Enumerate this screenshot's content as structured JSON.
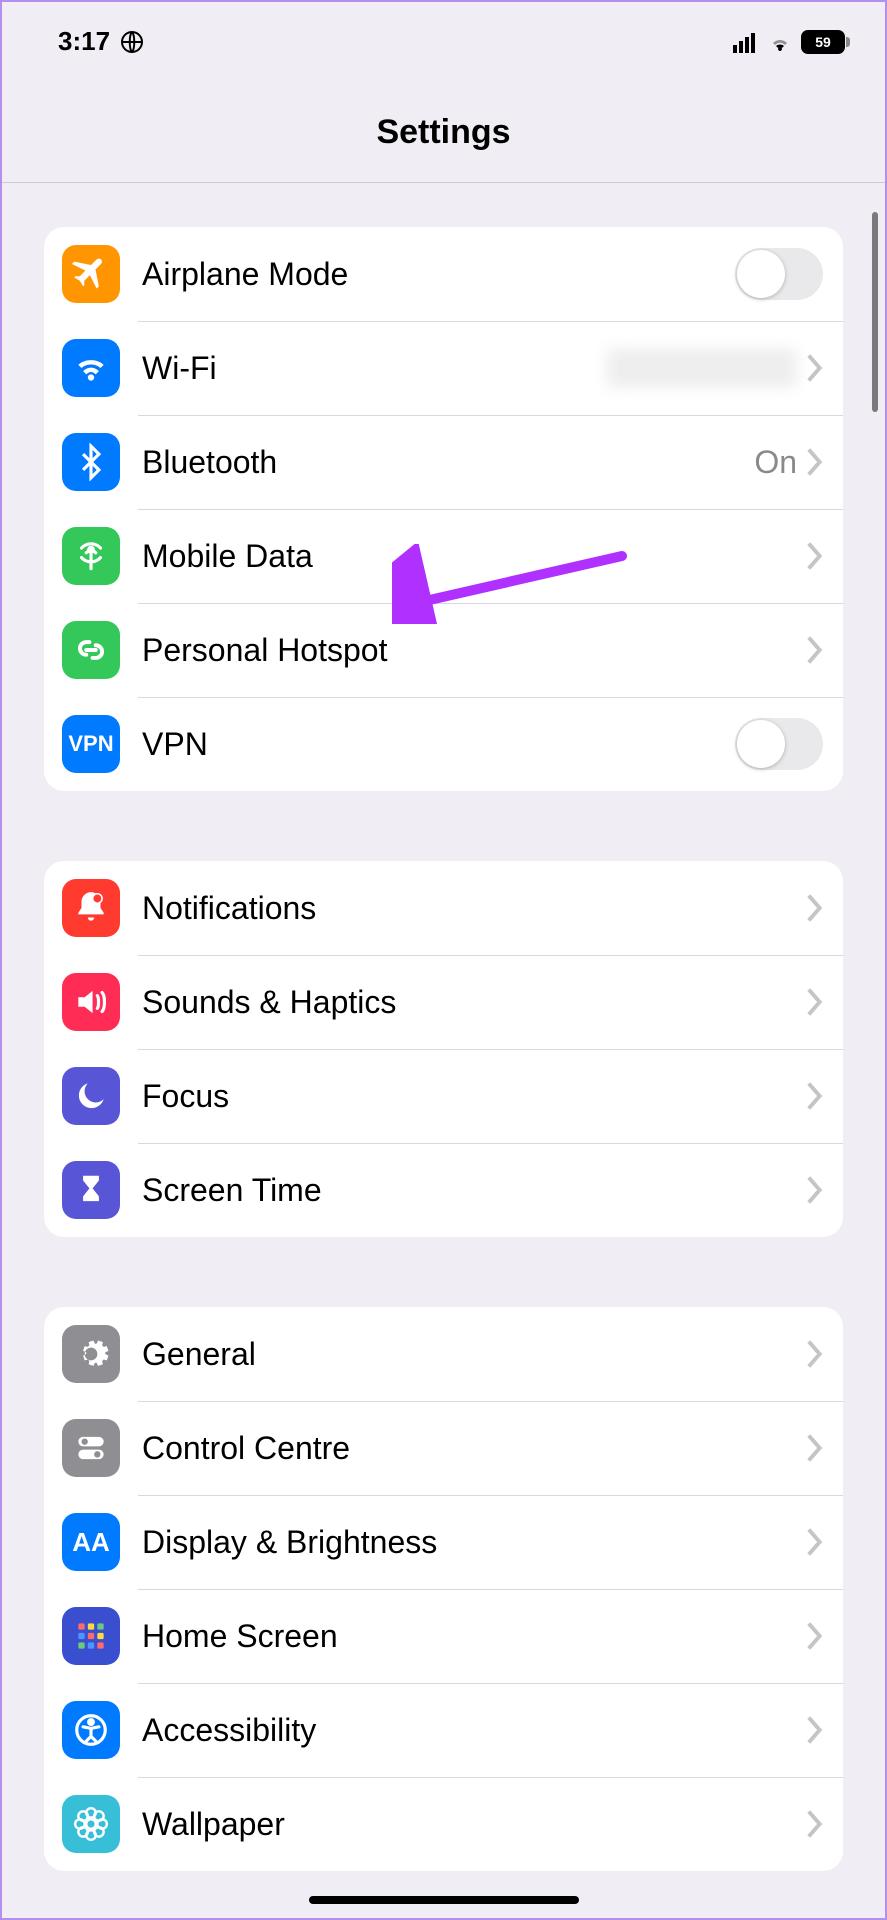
{
  "status": {
    "time": "3:17",
    "battery": "59"
  },
  "header": {
    "title": "Settings"
  },
  "groups": [
    {
      "id": "connectivity",
      "items": [
        {
          "key": "airplane",
          "label": "Airplane Mode",
          "icon": "airplane-icon",
          "iconColor": "#ff9500",
          "accessory": "toggle",
          "toggle": false
        },
        {
          "key": "wifi",
          "label": "Wi-Fi",
          "icon": "wifi-icon",
          "iconColor": "#007aff",
          "accessory": "blurred-disclosure"
        },
        {
          "key": "bluetooth",
          "label": "Bluetooth",
          "icon": "bluetooth-icon",
          "iconColor": "#007aff",
          "accessory": "value-disclosure",
          "value": "On"
        },
        {
          "key": "mobile-data",
          "label": "Mobile Data",
          "icon": "antenna-icon",
          "iconColor": "#34c759",
          "accessory": "disclosure"
        },
        {
          "key": "hotspot",
          "label": "Personal Hotspot",
          "icon": "hotspot-icon",
          "iconColor": "#34c759",
          "accessory": "disclosure"
        },
        {
          "key": "vpn",
          "label": "VPN",
          "icon": "vpn-icon",
          "iconColor": "#007aff",
          "accessory": "toggle",
          "toggle": false
        }
      ]
    },
    {
      "id": "alerts",
      "items": [
        {
          "key": "notifications",
          "label": "Notifications",
          "icon": "bell-icon",
          "iconColor": "#ff3b30",
          "accessory": "disclosure"
        },
        {
          "key": "sounds",
          "label": "Sounds & Haptics",
          "icon": "speaker-icon",
          "iconColor": "#ff2d55",
          "accessory": "disclosure"
        },
        {
          "key": "focus",
          "label": "Focus",
          "icon": "moon-icon",
          "iconColor": "#5856d6",
          "accessory": "disclosure"
        },
        {
          "key": "screentime",
          "label": "Screen Time",
          "icon": "hourglass-icon",
          "iconColor": "#5856d6",
          "accessory": "disclosure"
        }
      ]
    },
    {
      "id": "device",
      "items": [
        {
          "key": "general",
          "label": "General",
          "icon": "gear-icon",
          "iconColor": "#8e8e93",
          "accessory": "disclosure"
        },
        {
          "key": "controlcentre",
          "label": "Control Centre",
          "icon": "switches-icon",
          "iconColor": "#8e8e93",
          "accessory": "disclosure"
        },
        {
          "key": "display",
          "label": "Display & Brightness",
          "icon": "aa-icon",
          "iconColor": "#007aff",
          "accessory": "disclosure"
        },
        {
          "key": "homescreen",
          "label": "Home Screen",
          "icon": "grid-icon",
          "iconColor": "#3a4fcf",
          "accessory": "disclosure"
        },
        {
          "key": "accessibility",
          "label": "Accessibility",
          "icon": "accessibility-icon",
          "iconColor": "#007aff",
          "accessory": "disclosure"
        },
        {
          "key": "wallpaper",
          "label": "Wallpaper",
          "icon": "flower-icon",
          "iconColor": "#38bfd8",
          "accessory": "disclosure"
        }
      ]
    }
  ]
}
